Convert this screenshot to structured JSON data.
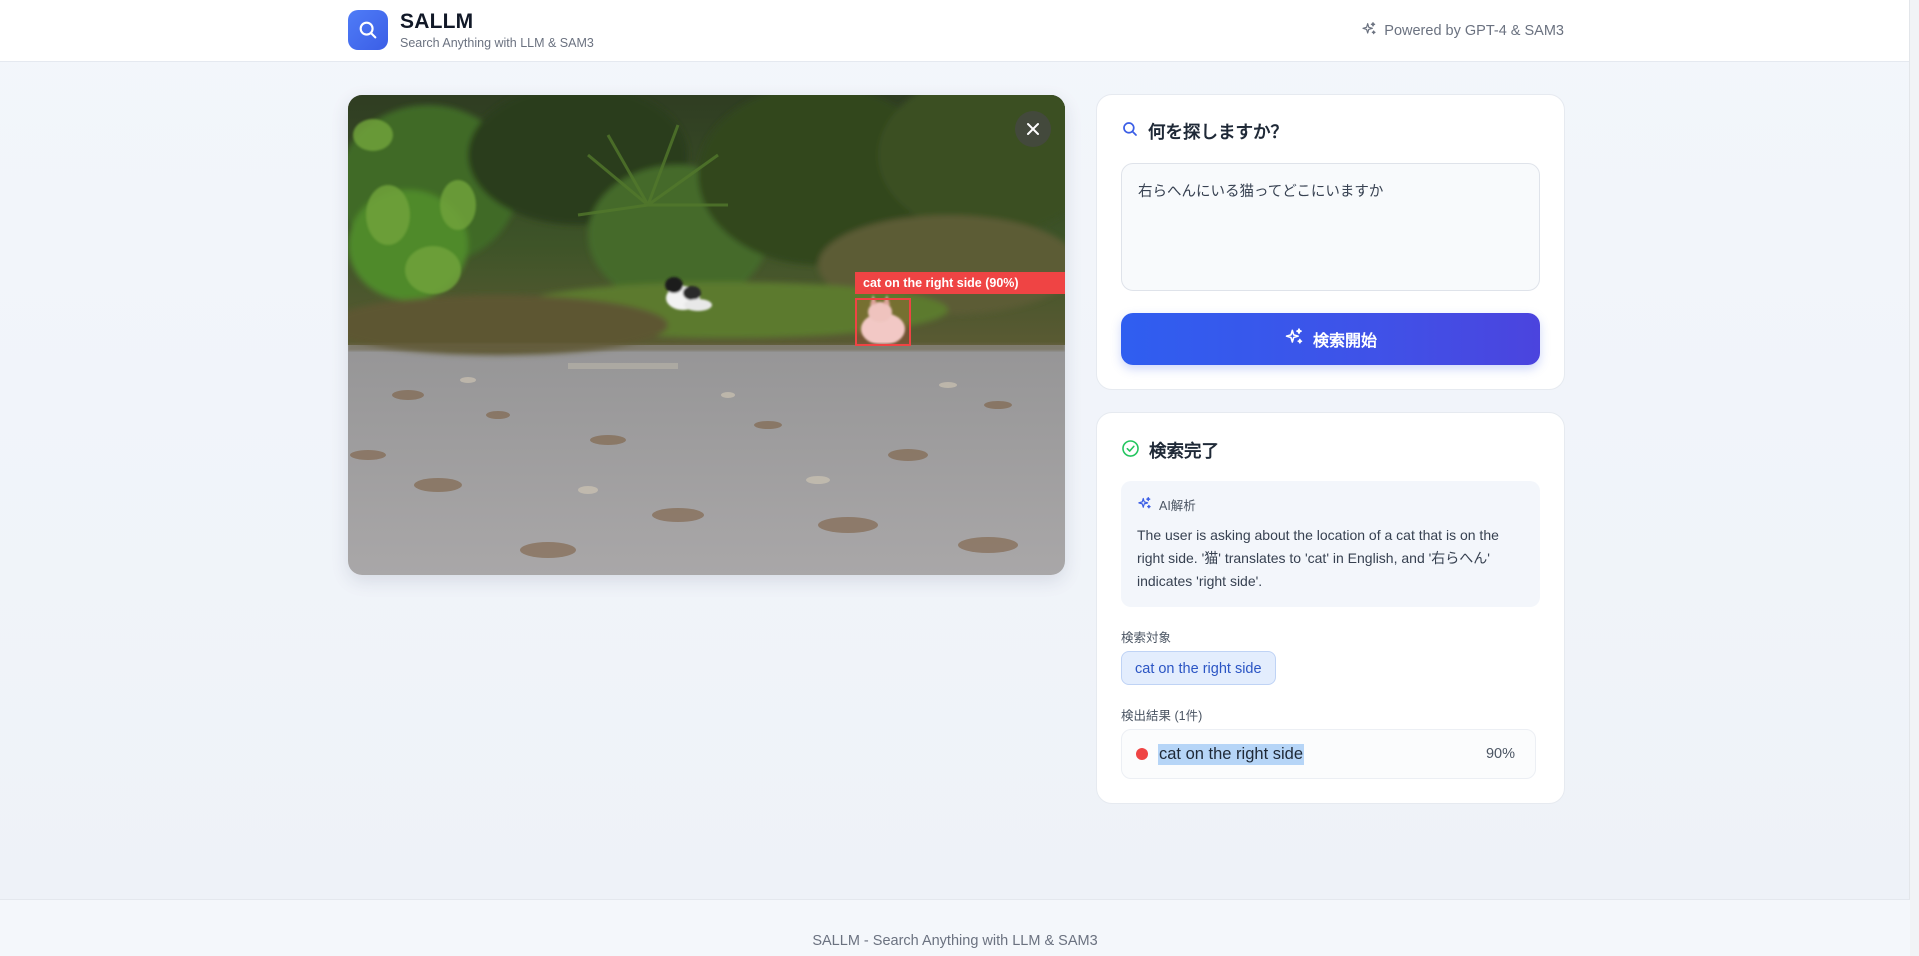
{
  "header": {
    "title": "SALLM",
    "subtitle": "Search Anything with LLM & SAM3",
    "powered_by": "Powered by GPT-4 & SAM3"
  },
  "image": {
    "detection_label": "cat on the right side (90%)"
  },
  "search": {
    "title": "何を探しますか？",
    "query": "右らへんにいる猫ってどこにいますか",
    "button_label": "検索開始"
  },
  "result": {
    "title": "検索完了",
    "analysis_label": "AI解析",
    "analysis_text": "The user is asking about the location of a cat that is on the right side. '猫' translates to 'cat' in English, and '右らへん' indicates 'right side'.",
    "target_label": "検索対象",
    "target": "cat on the right side",
    "detections_label": "検出結果 (1件)",
    "detections": [
      {
        "name": "cat on the right side",
        "score": "90%"
      }
    ]
  },
  "footer": {
    "text": "SALLM - Search Anything with LLM & SAM3"
  },
  "colors": {
    "accent": "#3b5ee6",
    "detection": "#ef4444",
    "success": "#22c55e"
  },
  "icons": {
    "logo": "search-icon",
    "powered": "sparkles-icon",
    "close": "close-icon",
    "search_title": "search-icon",
    "search_button": "sparkles-icon",
    "result_title": "check-circle-icon",
    "analysis": "sparkles-icon"
  }
}
